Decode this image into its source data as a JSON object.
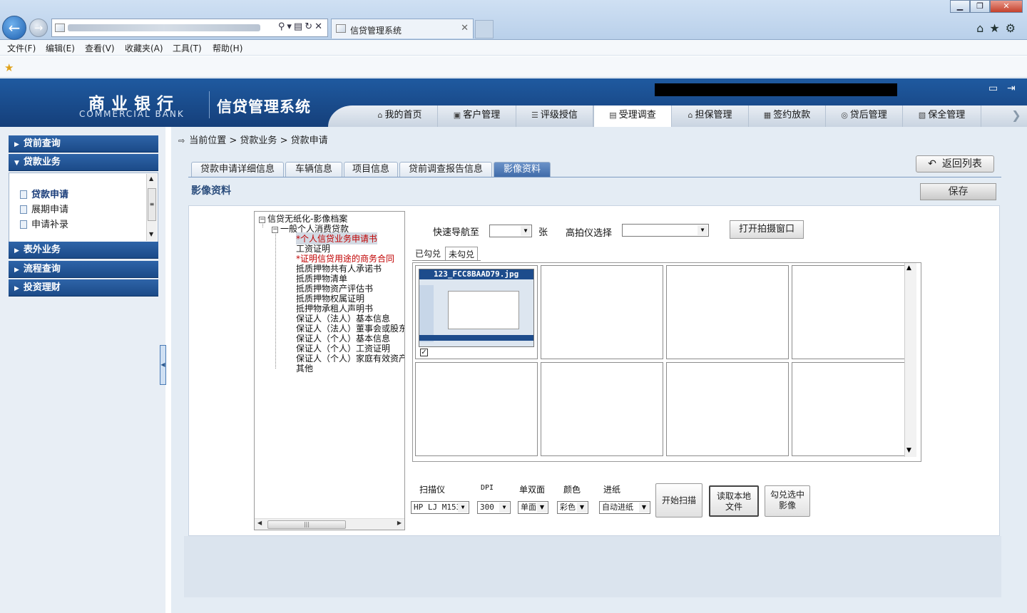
{
  "browser": {
    "tab_title": "信贷管理系统",
    "window_buttons": [
      "▁",
      "❐",
      "✕"
    ],
    "menu": [
      "文件(F)",
      "编辑(E)",
      "查看(V)",
      "收藏夹(A)",
      "工具(T)",
      "帮助(H)"
    ]
  },
  "header": {
    "bank_name_cn": "商业银行",
    "bank_name_en": "COMMERCIAL BANK",
    "system_title": "信贷管理系统",
    "nav_tabs": [
      {
        "label": "我的首页",
        "icon": "home-icon",
        "glyph": "⌂"
      },
      {
        "label": "客户管理",
        "icon": "customer-icon",
        "glyph": "▣"
      },
      {
        "label": "评级授信",
        "icon": "rating-icon",
        "glyph": "☰"
      },
      {
        "label": "受理调查",
        "icon": "survey-icon",
        "glyph": "▤"
      },
      {
        "label": "担保管理",
        "icon": "guarantee-icon",
        "glyph": "⌂"
      },
      {
        "label": "签约放款",
        "icon": "contract-icon",
        "glyph": "▦"
      },
      {
        "label": "贷后管理",
        "icon": "postloan-icon",
        "glyph": "◎"
      },
      {
        "label": "保全管理",
        "icon": "preserve-icon",
        "glyph": "▧"
      }
    ],
    "active_tab": "受理调查"
  },
  "sidebar": {
    "groups": [
      {
        "label": "贷前查询",
        "expanded": false
      },
      {
        "label": "贷款业务",
        "expanded": true
      },
      {
        "label": "表外业务",
        "expanded": false
      },
      {
        "label": "流程查询",
        "expanded": false
      },
      {
        "label": "投资理财",
        "expanded": false
      }
    ],
    "items": [
      "贷款申请",
      "展期申请",
      "申请补录"
    ],
    "active_item": "贷款申请"
  },
  "breadcrumb": {
    "label": "当前位置",
    "path": [
      "贷款业务",
      "贷款申请"
    ],
    "sep": ">"
  },
  "content_tabs": [
    "贷款申请详细信息",
    "车辆信息",
    "项目信息",
    "贷前调查报告信息",
    "影像资料"
  ],
  "active_content_tab": "影像资料",
  "buttons": {
    "back": "返回列表",
    "save": "保存",
    "open_capture": "打开拍摄窗口"
  },
  "section_title": "影像资料",
  "tree": {
    "root": "信贷无纸化-影像档案",
    "child": "一般个人消费贷款",
    "leaves": [
      {
        "label": "*个人信贷业务申请书",
        "required": true,
        "selected": true
      },
      {
        "label": "工资证明",
        "required": false
      },
      {
        "label": "*证明信贷用途的商务合同",
        "required": true
      },
      {
        "label": "抵质押物共有人承诺书",
        "required": false
      },
      {
        "label": "抵质押物清单",
        "required": false
      },
      {
        "label": "抵质押物资产评估书",
        "required": false
      },
      {
        "label": "抵质押物权属证明",
        "required": false
      },
      {
        "label": "抵押物承租人声明书",
        "required": false
      },
      {
        "label": "保证人（法人）基本信息",
        "required": false
      },
      {
        "label": "保证人（法人）董事会或股东会决议",
        "required": false
      },
      {
        "label": "保证人（个人）基本信息",
        "required": false
      },
      {
        "label": "保证人（个人）工资证明",
        "required": false
      },
      {
        "label": "保证人（个人）家庭有效资产证明",
        "required": false
      },
      {
        "label": "其他",
        "required": false
      }
    ]
  },
  "controls": {
    "quick_nav_label": "快速导航至",
    "quick_nav_value": "",
    "unit": "张",
    "camera_label": "高拍仪选择",
    "camera_value": ""
  },
  "image_tabs": [
    "已勾兑",
    "未勾兑"
  ],
  "active_image_tab": "未勾兑",
  "image_grid": {
    "thumbnail_filename": "123_FCC8BAAD79.jpg",
    "thumbnail_checked": true,
    "cells": 8
  },
  "scanner": {
    "scanner_label": "扫描仪",
    "scanner_value": "HP LJ M153",
    "dpi_label": "DPI",
    "dpi_value": "300",
    "duplex_label": "单双面",
    "duplex_value": "单面",
    "color_label": "颜色",
    "color_value": "彩色",
    "feed_label": "进纸",
    "feed_value": "自动进纸",
    "start_scan": "开始扫描",
    "read_local": "读取本地文件",
    "check_selected": "勾兑选中影像"
  }
}
